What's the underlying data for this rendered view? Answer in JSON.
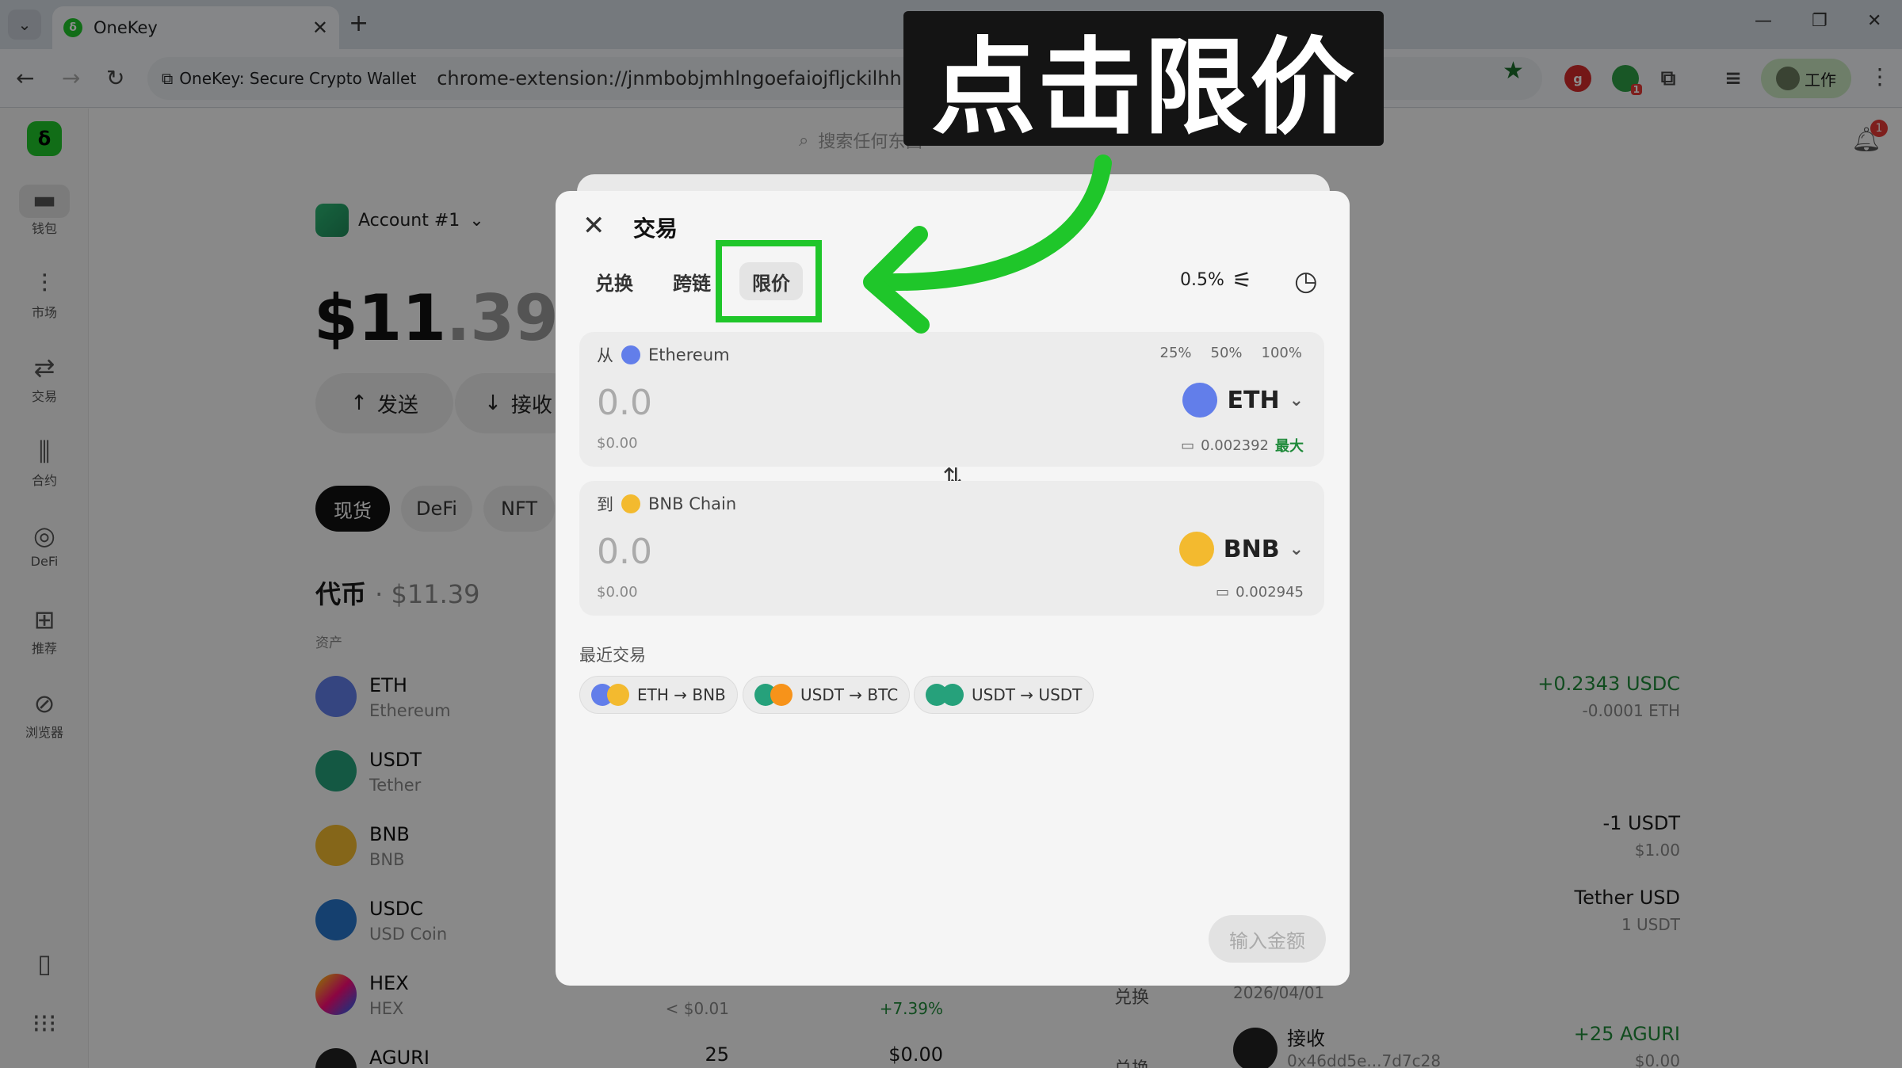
{
  "browser": {
    "tab_title": "OneKey",
    "site_chip": "OneKey: Secure Crypto Wallet",
    "url": "chrome-extension://jnmbobjmhlngoefaiojfljckilhhlhcj/ui-expand-tab.html#/",
    "profile_label": "工作",
    "ext_badge": "1"
  },
  "sidebar": {
    "items": [
      {
        "label": "钱包",
        "icon": "wallet-icon"
      },
      {
        "label": "市场",
        "icon": "market-icon"
      },
      {
        "label": "交易",
        "icon": "swap-icon"
      },
      {
        "label": "合约",
        "icon": "perps-icon"
      },
      {
        "label": "DeFi",
        "icon": "defi-icon"
      },
      {
        "label": "推荐",
        "icon": "gift-icon"
      },
      {
        "label": "浏览器",
        "icon": "compass-icon"
      }
    ]
  },
  "header": {
    "search_placeholder": "搜索任何东西",
    "notif_count": "1"
  },
  "wallet": {
    "account": "Account #1",
    "balance_int": "$11",
    "balance_frac": ".39",
    "send": "发送",
    "receive": "接收",
    "segments": [
      "现货",
      "DeFi",
      "NFT"
    ],
    "tokens_title": "代币",
    "tokens_value": "· $11.39",
    "assets_label": "资产",
    "tokens": [
      {
        "symbol": "ETH",
        "name": "Ethereum",
        "color": "#627eea"
      },
      {
        "symbol": "USDT",
        "name": "Tether",
        "color": "#26a17b"
      },
      {
        "symbol": "BNB",
        "name": "BNB",
        "color": "#f3ba2f"
      },
      {
        "symbol": "USDC",
        "name": "USD Coin",
        "color": "#2775ca"
      },
      {
        "symbol": "HEX",
        "name": "HEX",
        "color": "#e84393"
      },
      {
        "symbol": "AGURI",
        "name": "",
        "color": "#222222"
      }
    ],
    "hex_price": "< $0.01",
    "hex_change": "+7.39%",
    "aguri_amount": "25",
    "aguri_value": "$0.00",
    "row_action": "兑换",
    "right": {
      "tx1_amount": "+0.2343 USDC",
      "tx1_sub": "-0.0001 ETH",
      "tx2_amount": "-1 USDT",
      "tx2_sub": "$1.00",
      "tx3_amount": "Tether USD",
      "tx3_sub": "1 USDT",
      "date": "2026/04/01",
      "tx4_type": "接收",
      "tx4_addr": "0x46dd5e...7d7c28",
      "tx4_amount": "+25 AGURI",
      "tx4_sub": "$0.00"
    }
  },
  "modal": {
    "title": "交易",
    "tabs": [
      "兑换",
      "跨链",
      "限价"
    ],
    "active_tab": 2,
    "slippage": "0.5%",
    "from": {
      "prefix": "从",
      "network": "Ethereum",
      "amount": "0.0",
      "usd": "$0.00",
      "token": "ETH",
      "balance": "0.002392",
      "max": "最大",
      "pcts": [
        "25%",
        "50%",
        "100%"
      ]
    },
    "to": {
      "prefix": "到",
      "network": "BNB Chain",
      "amount": "0.0",
      "usd": "$0.00",
      "token": "BNB",
      "balance": "0.002945"
    },
    "recent_label": "最近交易",
    "recent": [
      "ETH → BNB",
      "USDT → BTC",
      "USDT → USDT"
    ],
    "enter_amount": "输入金额"
  },
  "annotation": {
    "callout": "点击限价"
  },
  "colors": {
    "accent_green": "#1fc62a",
    "eth": "#627eea",
    "bnb": "#f3ba2f",
    "usdt": "#26a17b",
    "btc": "#f7931a"
  }
}
